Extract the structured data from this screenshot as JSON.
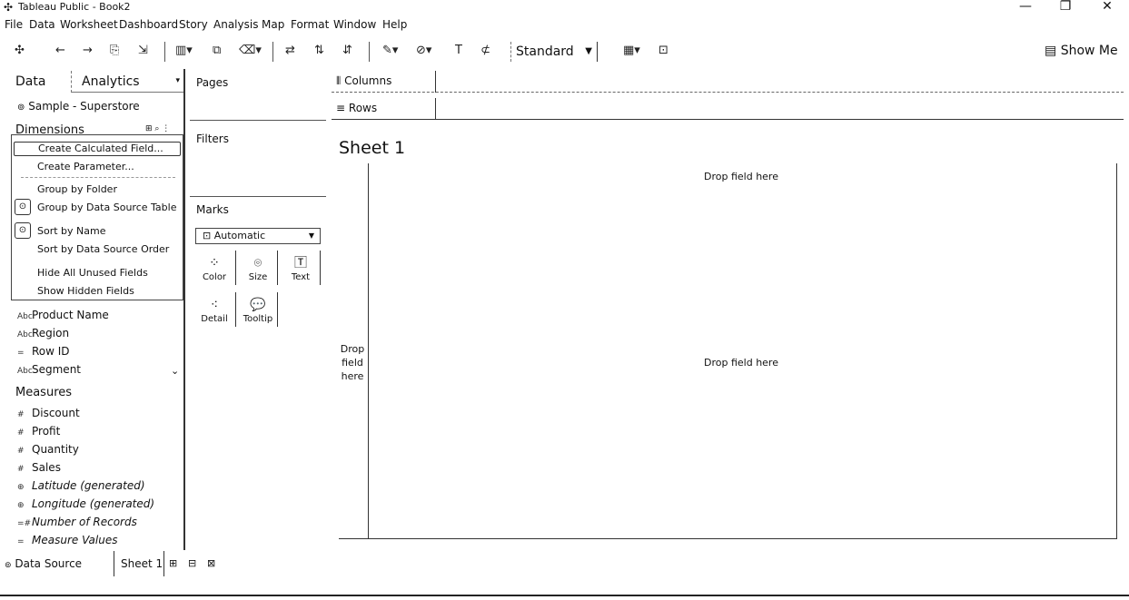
{
  "window": {
    "title": "Tableau Public - Book2",
    "controls": [
      "—",
      "❐",
      "✕"
    ]
  },
  "menu": [
    "File",
    "Data",
    "Worksheet",
    "Dashboard",
    "Story",
    "Analysis",
    "Map",
    "Format",
    "Window",
    "Help"
  ],
  "toolbar": {
    "fit": "Standard",
    "show_me": "Show Me"
  },
  "left_pane": {
    "tab_data": "Data",
    "tab_analytics": "Analytics",
    "data_source": "Sample - Superstore",
    "dimensions_label": "Dimensions",
    "menu_items": {
      "create_calc": "Create Calculated Field...",
      "create_param": "Create Parameter...",
      "group_folder": "Group by Folder",
      "group_table": "Group by Data Source Table",
      "sort_name": "Sort by Name",
      "sort_order": "Sort by Data Source Order",
      "hide_unused": "Hide All Unused Fields",
      "show_hidden": "Show Hidden Fields"
    },
    "dimensions": [
      {
        "icon": "Abc",
        "name": "Product Name"
      },
      {
        "icon": "Abc",
        "name": "Region"
      },
      {
        "icon": "=",
        "name": "Row ID"
      },
      {
        "icon": "Abc",
        "name": "Segment"
      }
    ],
    "measures_label": "Measures",
    "measures": [
      {
        "icon": "#",
        "name": "Discount"
      },
      {
        "icon": "#",
        "name": "Profit"
      },
      {
        "icon": "#",
        "name": "Quantity"
      },
      {
        "icon": "#",
        "name": "Sales"
      },
      {
        "icon": "⊕",
        "name": "Latitude (generated)"
      },
      {
        "icon": "⊕",
        "name": "Longitude (generated)"
      },
      {
        "icon": "=#",
        "name": "Number of Records"
      },
      {
        "icon": "=",
        "name": "Measure Values"
      }
    ]
  },
  "shelves": {
    "pages": "Pages",
    "filters": "Filters",
    "marks": "Marks",
    "mark_type": "Automatic",
    "mark_buttons": {
      "color": "Color",
      "size": "Size",
      "text": "Text",
      "detail": "Detail",
      "tooltip": "Tooltip"
    },
    "columns": "Columns",
    "rows": "Rows"
  },
  "sheet": {
    "title": "Sheet 1",
    "drop_top": "Drop field here",
    "drop_center": "Drop field here",
    "drop_left": "Drop field here"
  },
  "bottom_tabs": {
    "data_source": "Data Source",
    "sheet1": "Sheet 1"
  }
}
